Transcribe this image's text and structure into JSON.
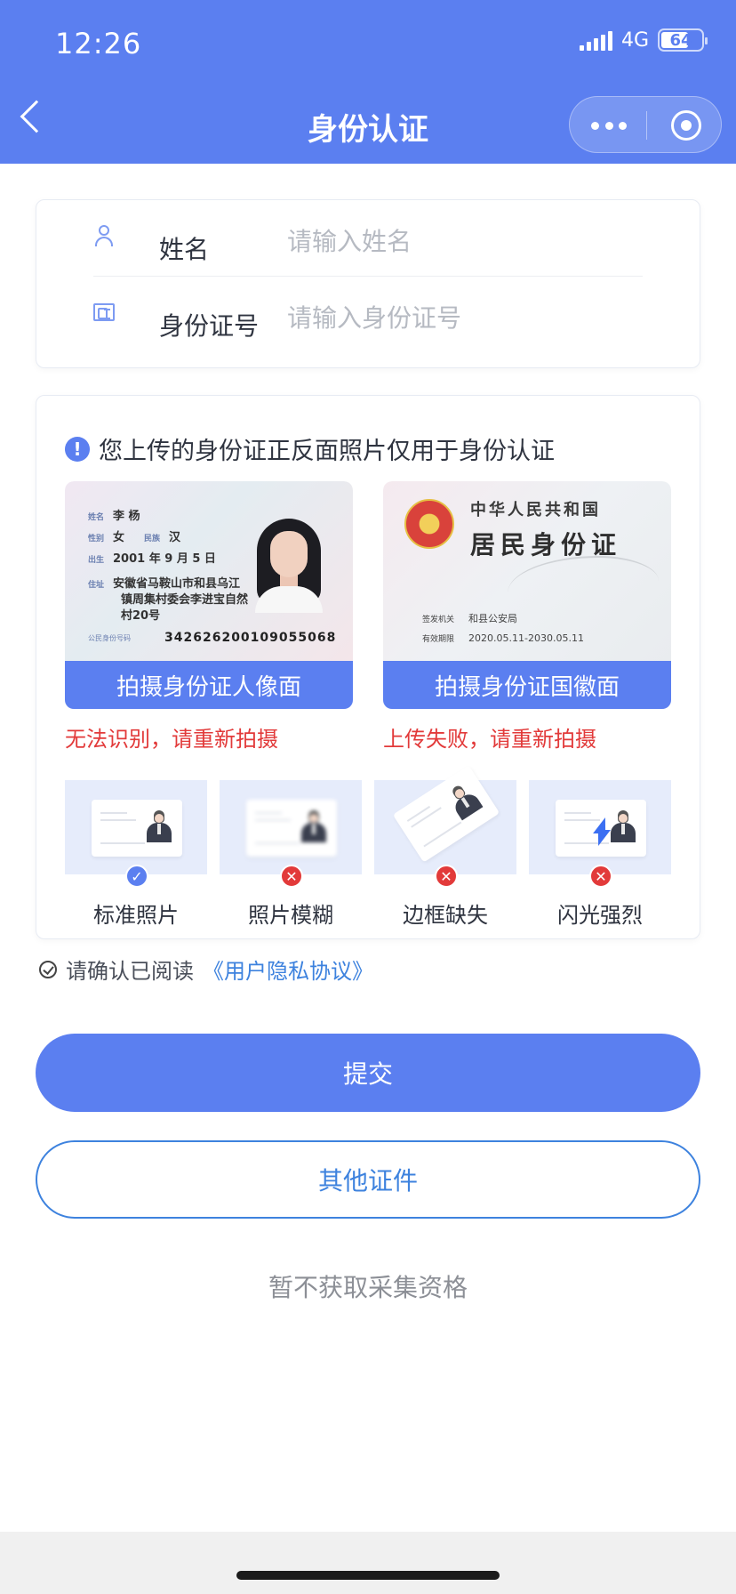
{
  "status_bar": {
    "time": "12:26",
    "network": "4G",
    "battery": "64"
  },
  "nav": {
    "title": "身份认证"
  },
  "form": {
    "name": {
      "label": "姓名",
      "placeholder": "请输入姓名"
    },
    "id_number": {
      "label": "身份证号",
      "placeholder": "请输入身份证号"
    }
  },
  "upload": {
    "notice": "您上传的身份证正反面照片仅用于身份认证",
    "front": {
      "button": "拍摄身份证人像面",
      "error": "无法识别，请重新拍摄",
      "card": {
        "name_key": "姓名",
        "name": "李 杨",
        "sex_key": "性别",
        "sex": "女",
        "nation_key": "民族",
        "nation": "汉",
        "birth_key": "出生",
        "birth": "2001 年 9 月 5 日",
        "addr_key": "住址",
        "addr1": "安徽省马鞍山市和县乌江",
        "addr2": "镇周集村委会李进宝自然",
        "addr3": "村20号",
        "id_key": "公民身份号码",
        "id": "342626200109055068"
      }
    },
    "back": {
      "button": "拍摄身份证国徽面",
      "error": "上传失败，请重新拍摄",
      "card": {
        "line1": "中华人民共和国",
        "line2": "居民身份证",
        "authority_key": "签发机关",
        "authority": "和县公安局",
        "valid_key": "有效期限",
        "valid": "2020.05.11-2030.05.11"
      }
    },
    "samples": [
      {
        "label": "标准照片",
        "status": "ok",
        "mark": "✓"
      },
      {
        "label": "照片模糊",
        "status": "bad",
        "mark": "✕"
      },
      {
        "label": "边框缺失",
        "status": "bad",
        "mark": "✕"
      },
      {
        "label": "闪光强烈",
        "status": "bad",
        "mark": "✕"
      }
    ]
  },
  "agreement": {
    "text": "请确认已阅读",
    "link": "《用户隐私协议》"
  },
  "buttons": {
    "submit": "提交",
    "other": "其他证件",
    "skip": "暂不获取采集资格"
  },
  "colors": {
    "primary": "#5b7ff0",
    "error": "#e23a3a",
    "link": "#3d82de"
  }
}
